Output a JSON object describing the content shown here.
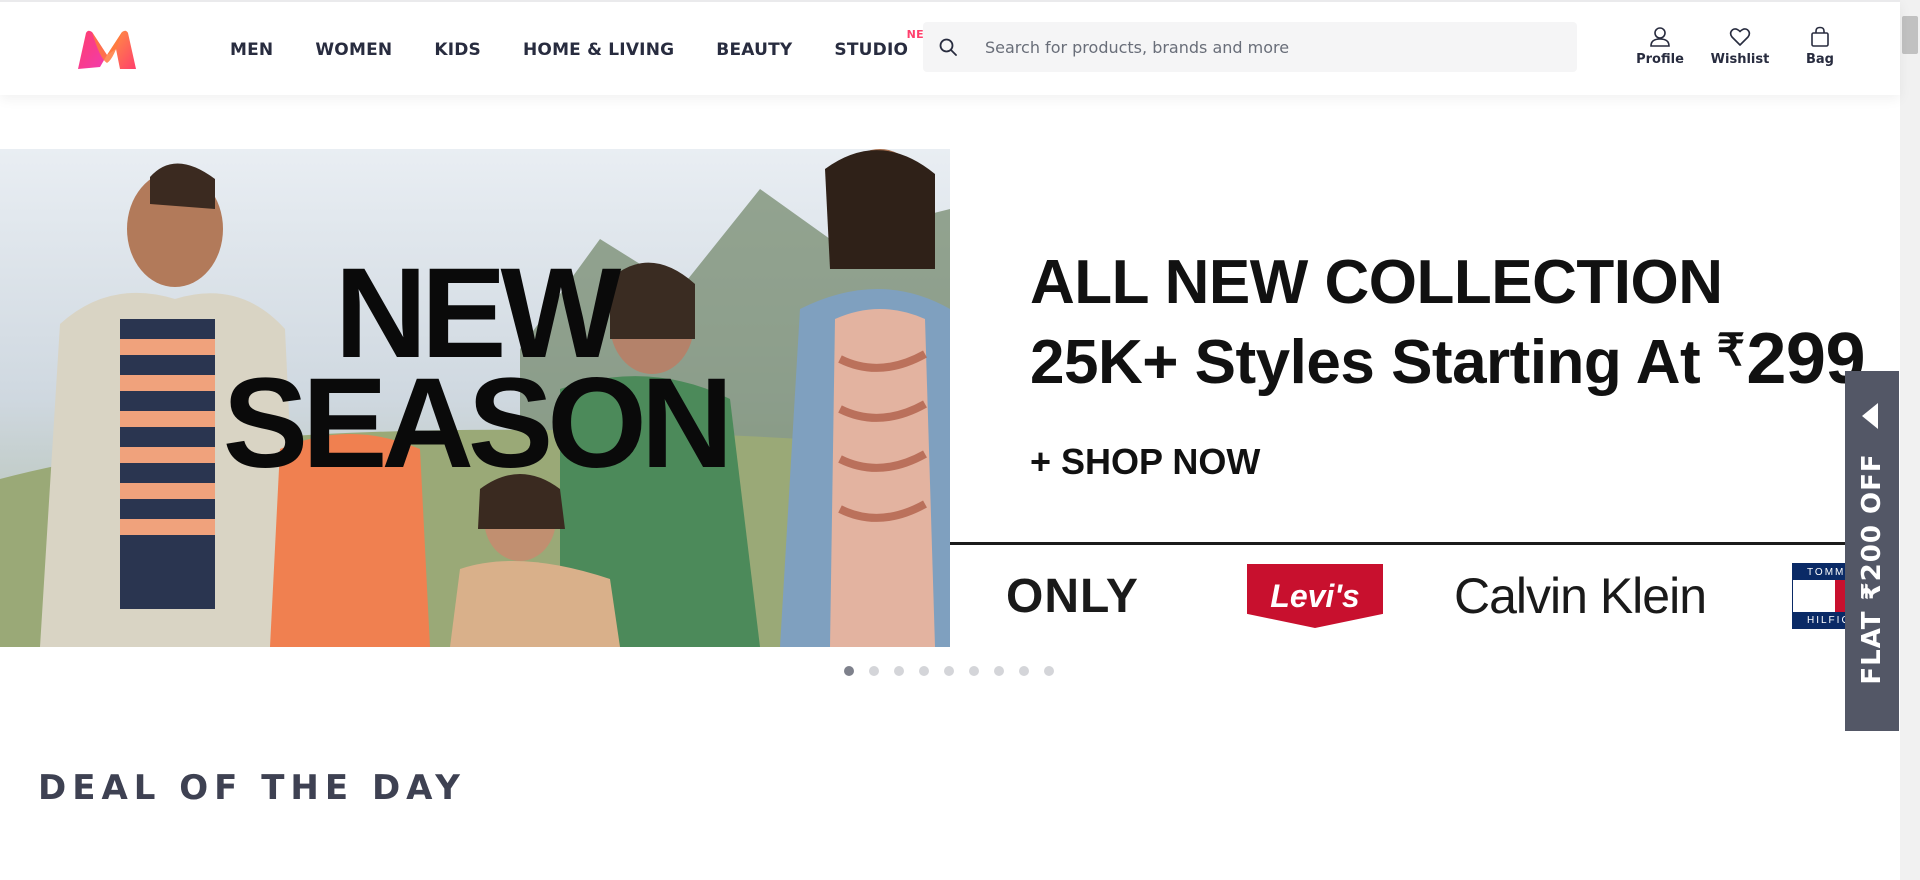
{
  "header": {
    "logo_name": "myntra-logo",
    "nav": [
      {
        "label": "MEN"
      },
      {
        "label": "WOMEN"
      },
      {
        "label": "KIDS"
      },
      {
        "label": "HOME & LIVING"
      },
      {
        "label": "BEAUTY"
      },
      {
        "label": "STUDIO",
        "tag": "NEW"
      }
    ],
    "search": {
      "placeholder": "Search for products, brands and more",
      "icon": "search-icon"
    },
    "actions": [
      {
        "label": "Profile",
        "icon": "user-icon"
      },
      {
        "label": "Wishlist",
        "icon": "heart-icon"
      },
      {
        "label": "Bag",
        "icon": "bag-icon"
      }
    ]
  },
  "banner": {
    "hero_title_line1": "NEW",
    "hero_title_line2": "SEASON",
    "promo_line1": "ALL NEW COLLECTION",
    "promo_line2_prefix": "25K+ Styles Starting At ",
    "currency": "₹",
    "price": "299",
    "cta": "+ SHOP NOW",
    "brands": {
      "only": "ONLY",
      "levis": "Levi's",
      "ck": "Calvin Klein",
      "tommy_top": "TOMMY",
      "tommy_bottom": "HILFIGER"
    }
  },
  "carousel": {
    "total_slides": 9,
    "active_index": 0
  },
  "coupon": {
    "text": "FLAT ₹200 OFF"
  },
  "sections": {
    "deal_title": "DEAL OF THE DAY"
  },
  "colors": {
    "accent": "#ff3f6c",
    "text": "#282c3f",
    "coupon_bg": "#535766",
    "levis_red": "#c8102e"
  }
}
